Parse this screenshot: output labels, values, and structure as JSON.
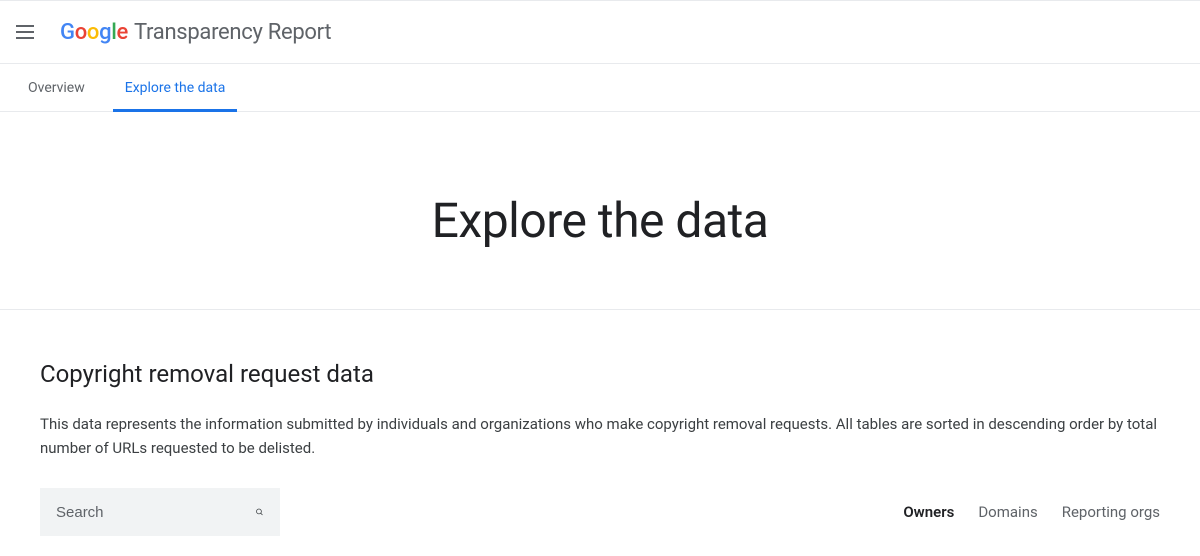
{
  "header": {
    "logo_word": "Google",
    "logo_rest": "Transparency Report"
  },
  "tabs": {
    "overview": "Overview",
    "explore": "Explore the data"
  },
  "hero": {
    "title": "Explore the data"
  },
  "section": {
    "title": "Copyright removal request data",
    "description": "This data represents the information submitted by individuals and organizations who make copyright removal requests. All tables are sorted in descending order by total number of URLs requested to be delisted."
  },
  "search": {
    "placeholder": "Search"
  },
  "filters": {
    "owners": "Owners",
    "domains": "Domains",
    "reporting_orgs": "Reporting orgs"
  }
}
